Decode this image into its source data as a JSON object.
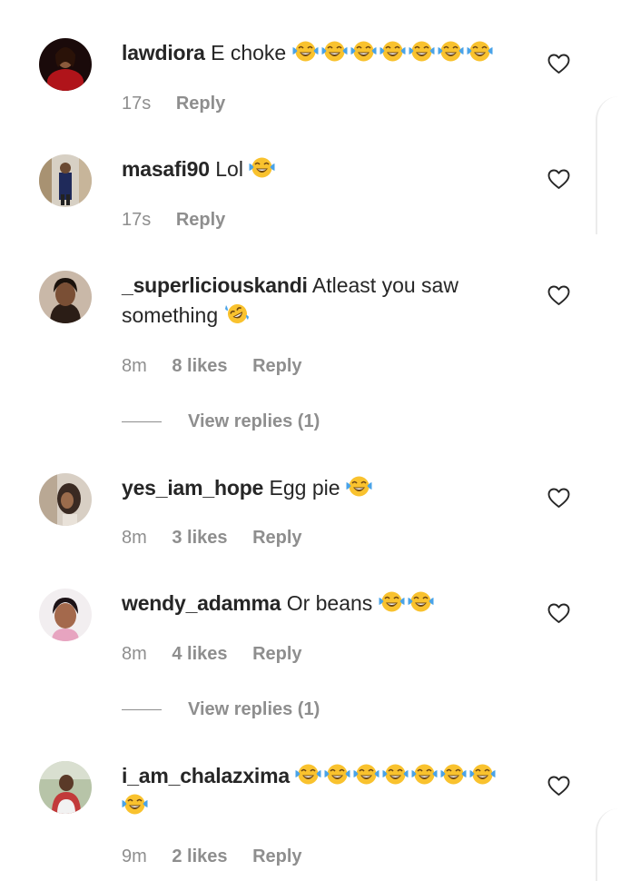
{
  "comments": [
    {
      "username": "lawdiora",
      "text": "E choke",
      "emoji": [
        "face-with-tears-of-joy",
        "face-with-tears-of-joy",
        "face-with-tears-of-joy",
        "face-with-tears-of-joy",
        "face-with-tears-of-joy",
        "face-with-tears-of-joy",
        "face-with-tears-of-joy"
      ],
      "time": "17s",
      "likes": "",
      "reply_label": "Reply"
    },
    {
      "username": "masafi90",
      "text": "Lol",
      "emoji": [
        "face-with-tears-of-joy"
      ],
      "time": "17s",
      "likes": "",
      "reply_label": "Reply"
    },
    {
      "username": "_superliciouskandi",
      "text": "Atleast you saw something",
      "emoji": [
        "rolling-on-the-floor-laughing"
      ],
      "time": "8m",
      "likes": "8 likes",
      "reply_label": "Reply",
      "view_replies": "View replies (1)"
    },
    {
      "username": "yes_iam_hope",
      "text": "Egg pie",
      "emoji": [
        "face-with-tears-of-joy"
      ],
      "time": "8m",
      "likes": "3 likes",
      "reply_label": "Reply"
    },
    {
      "username": "wendy_adamma",
      "text": "Or beans",
      "emoji": [
        "face-with-tears-of-joy",
        "face-with-tears-of-joy"
      ],
      "time": "8m",
      "likes": "4 likes",
      "reply_label": "Reply",
      "view_replies": "View replies (1)"
    },
    {
      "username": "i_am_chalazxima",
      "text": "",
      "emoji": [
        "face-with-tears-of-joy",
        "face-with-tears-of-joy",
        "face-with-tears-of-joy",
        "face-with-tears-of-joy",
        "face-with-tears-of-joy",
        "face-with-tears-of-joy",
        "face-with-tears-of-joy",
        "face-with-tears-of-joy"
      ],
      "time": "9m",
      "likes": "2 likes",
      "reply_label": "Reply"
    }
  ],
  "icons": {
    "like": "heart-outline-icon"
  },
  "colors": {
    "text": "#262626",
    "secondary": "#8e8e8e",
    "emoji_face": "#f9c22e",
    "emoji_tear": "#4aa3e8"
  }
}
